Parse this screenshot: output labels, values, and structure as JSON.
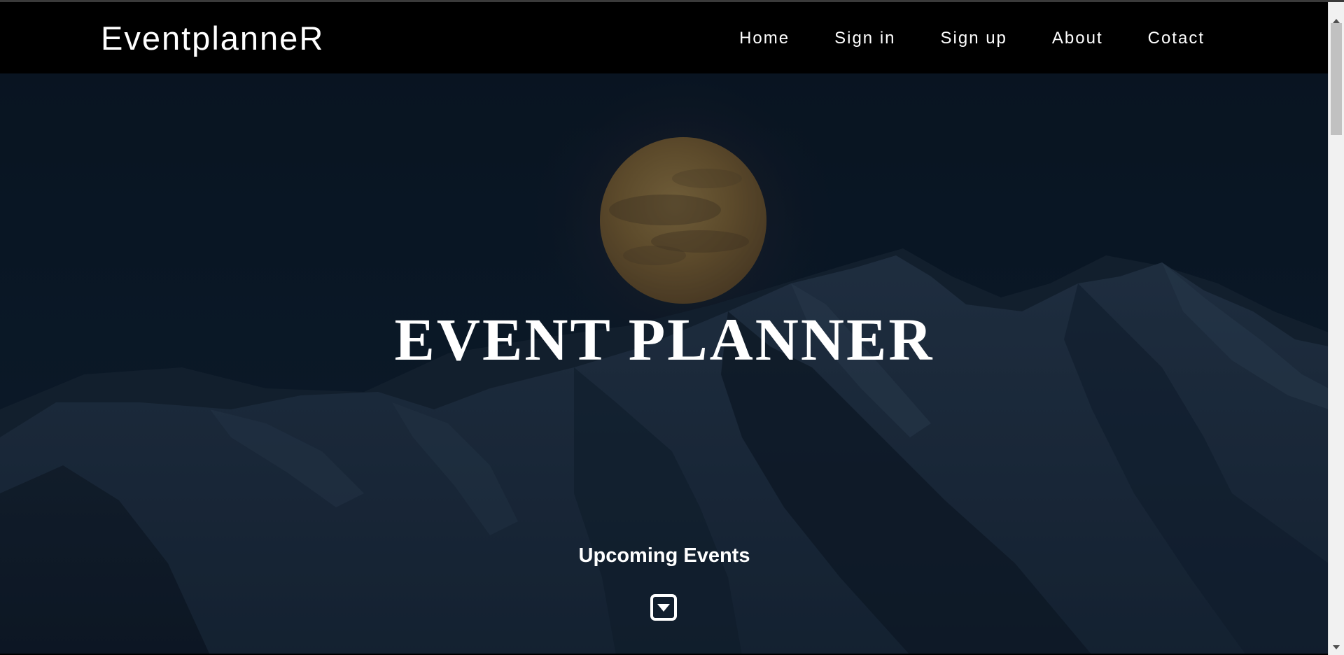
{
  "navbar": {
    "brand": "EventplanneR",
    "links": [
      "Home",
      "Sign in",
      "Sign up",
      "About",
      "Cotact"
    ]
  },
  "hero": {
    "title": "EVENT PLANNER",
    "section_heading": "Upcoming Events",
    "scroll_down_icon": "caret-down-square-icon"
  },
  "colors": {
    "navbar_background": "#000000",
    "hero_background": "#0d1b2a",
    "moon": "#a07a3a",
    "text": "#ffffff"
  }
}
